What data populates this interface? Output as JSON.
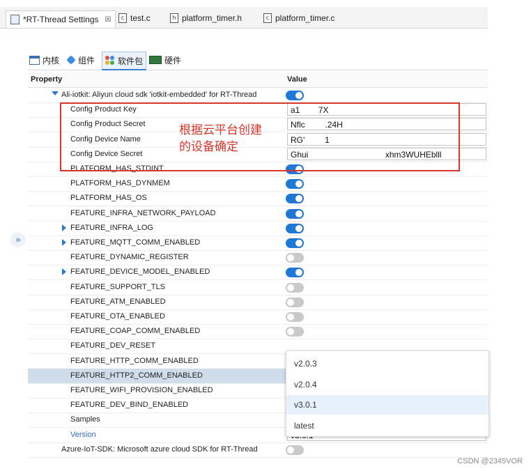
{
  "tabs": [
    {
      "label": "*RT-Thread Settings",
      "icon": "settings-icon",
      "close": "☒"
    },
    {
      "label": "test.c",
      "icon": "c-file-icon",
      "glyph": "c"
    },
    {
      "label": "platform_timer.h",
      "icon": "h-file-icon",
      "glyph": "h"
    },
    {
      "label": "platform_timer.c",
      "icon": "c-file-icon",
      "glyph": "c"
    }
  ],
  "subtabs": [
    {
      "label": "内核",
      "icon": "kernel-icon"
    },
    {
      "label": "组件",
      "icon": "component-icon"
    },
    {
      "label": "软件包",
      "icon": "package-icon"
    },
    {
      "label": "硬件",
      "icon": "hardware-icon"
    }
  ],
  "table": {
    "header_property": "Property",
    "header_value": "Value",
    "rows": [
      {
        "name": "Ali-iotkit: Aliyun cloud sdk 'iotkit-embedded' for RT-Thread",
        "arrow": "down",
        "toggle": "on"
      },
      {
        "name": "Config Product Key",
        "value": "a1           7X"
      },
      {
        "name": "Config Product Secret",
        "value": "Nflc            .24H"
      },
      {
        "name": "Config Device Name",
        "value": "RG'            1"
      },
      {
        "name": "Config Device Secret",
        "value": "Ghui                                              xhm3WUHEblll"
      },
      {
        "name": "PLATFORM_HAS_STDINT",
        "toggle": "on"
      },
      {
        "name": "PLATFORM_HAS_DYNMEM",
        "toggle": "on"
      },
      {
        "name": "PLATFORM_HAS_OS",
        "toggle": "on"
      },
      {
        "name": "FEATURE_INFRA_NETWORK_PAYLOAD",
        "toggle": "on"
      },
      {
        "name": "FEATURE_INFRA_LOG",
        "arrow": "right",
        "toggle": "on"
      },
      {
        "name": "FEATURE_MQTT_COMM_ENABLED",
        "arrow": "right",
        "toggle": "on"
      },
      {
        "name": "FEATURE_DYNAMIC_REGISTER",
        "toggle": "off"
      },
      {
        "name": "FEATURE_DEVICE_MODEL_ENABLED",
        "arrow": "right",
        "toggle": "on"
      },
      {
        "name": "FEATURE_SUPPORT_TLS",
        "toggle": "off"
      },
      {
        "name": "FEATURE_ATM_ENABLED",
        "toggle": "off"
      },
      {
        "name": "FEATURE_OTA_ENABLED",
        "toggle": "off"
      },
      {
        "name": "FEATURE_COAP_COMM_ENABLED",
        "toggle": "off"
      },
      {
        "name": "FEATURE_DEV_RESET"
      },
      {
        "name": "FEATURE_HTTP_COMM_ENABLED"
      },
      {
        "name": "FEATURE_HTTP2_COMM_ENABLED",
        "selected": true
      },
      {
        "name": "FEATURE_WIFI_PROVISION_ENABLED"
      },
      {
        "name": "FEATURE_DEV_BIND_ENABLED"
      },
      {
        "name": "Samples"
      },
      {
        "name": "Version",
        "value": "v3.0.1",
        "blue": true
      },
      {
        "name": "Azure-IoT-SDK: Microsoft azure cloud SDK for RT-Thread",
        "toggle": "off"
      }
    ]
  },
  "annotation": "根据云平台创建\n的设备确定",
  "version_dropdown": {
    "options": [
      "v2.0.3",
      "v2.0.4",
      "v3.0.1",
      "latest"
    ],
    "highlighted": "v3.0.1"
  },
  "expand_glyph": "»",
  "watermark": "CSDN @2345VOR",
  "colors": {
    "accent": "#1f78d6",
    "annotation": "#d9352b",
    "selected_row": "#cfdcea"
  }
}
